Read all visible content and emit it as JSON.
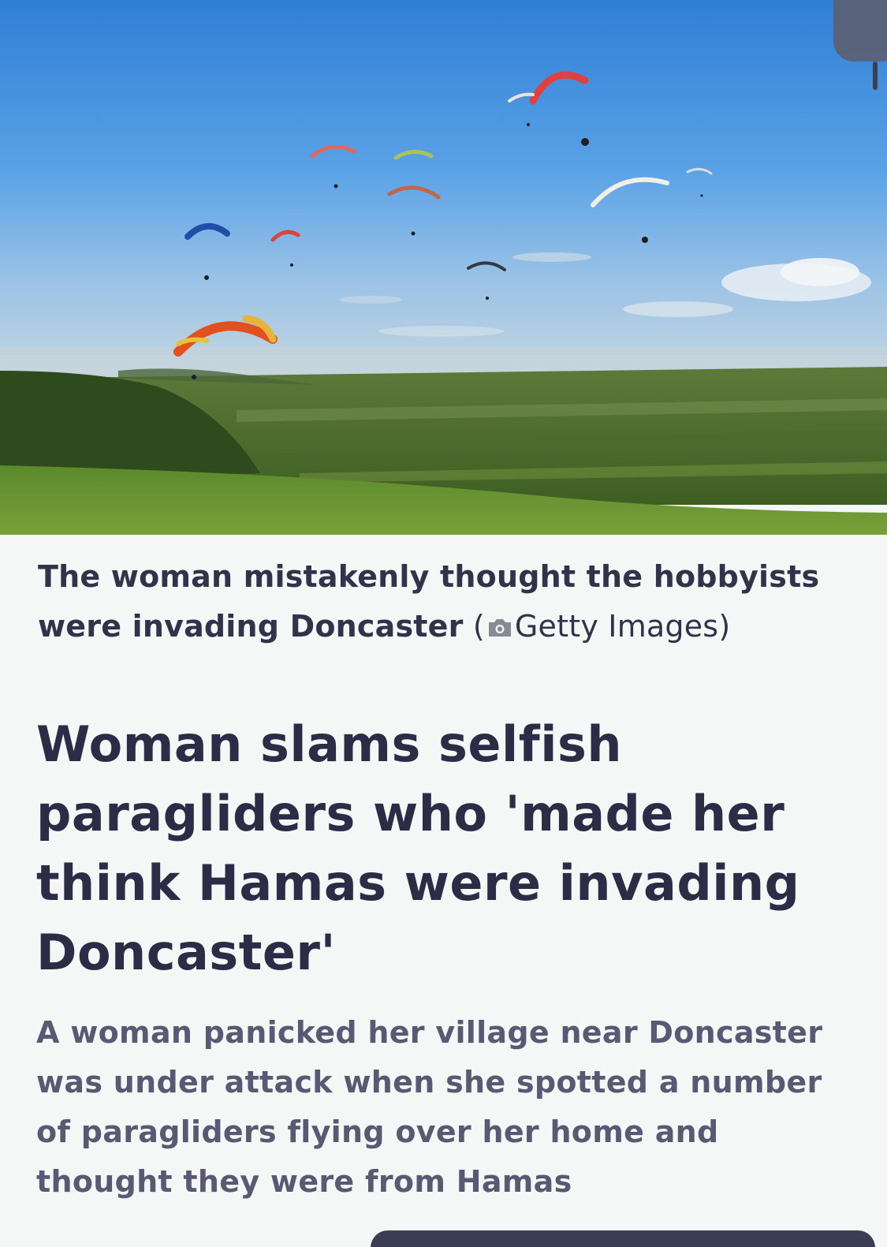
{
  "image": {
    "alt": "Paragliders flying over green countryside hills under a blue sky"
  },
  "caption": {
    "text": "The woman mistakenly thought the hobbyists were invading Doncaster",
    "credit_open": " (",
    "credit": "Getty Images",
    "credit_close": ")",
    "credit_icon": "camera-icon"
  },
  "article": {
    "headline": "Woman slams selfish paragliders who 'made her think Hamas were invading Doncaster'",
    "standfirst": "A woman panicked her village near Doncaster was under attack when she spotted a number of paragliders flying over her home and thought they were from Hamas"
  },
  "colors": {
    "text_primary": "#2e2b47",
    "text_secondary": "#5a5872",
    "background": "#f5f6f6"
  }
}
